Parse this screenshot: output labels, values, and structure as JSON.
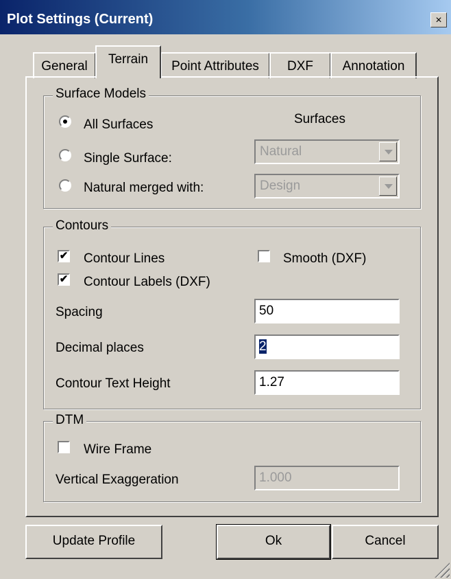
{
  "window": {
    "title": "Plot Settings  (Current)",
    "close_glyph": "×"
  },
  "tabs": [
    {
      "label": "General",
      "active": false
    },
    {
      "label": "Terrain",
      "active": true
    },
    {
      "label": "Point Attributes",
      "active": false
    },
    {
      "label": "DXF",
      "active": false
    },
    {
      "label": "Annotation",
      "active": false
    }
  ],
  "surface_models": {
    "group_label": "Surface Models",
    "surfaces_header": "Surfaces",
    "options": [
      {
        "label": "All Surfaces",
        "checked": true
      },
      {
        "label": "Single Surface:",
        "checked": false
      },
      {
        "label": "Natural merged with:",
        "checked": false
      }
    ],
    "single_surface_select": "Natural",
    "merged_with_select": "Design"
  },
  "contours": {
    "group_label": "Contours",
    "contour_lines": {
      "label": "Contour Lines",
      "checked": true
    },
    "smooth_dxf": {
      "label": "Smooth (DXF)",
      "checked": false
    },
    "contour_labels": {
      "label": "Contour Labels (DXF)",
      "checked": true
    },
    "spacing": {
      "label": "Spacing",
      "value": "50"
    },
    "decimal_places": {
      "label": "Decimal places",
      "value": "2"
    },
    "text_height": {
      "label": "Contour Text Height",
      "value": "1.27"
    }
  },
  "dtm": {
    "group_label": "DTM",
    "wire_frame": {
      "label": "Wire Frame",
      "checked": false
    },
    "vertical_exaggeration": {
      "label": "Vertical Exaggeration",
      "value": "1.000"
    }
  },
  "buttons": {
    "update_profile": "Update Profile",
    "ok": "Ok",
    "cancel": "Cancel"
  },
  "icons": {
    "check_mark": "✔"
  },
  "colors": {
    "titlebar_start": "#0a246a",
    "titlebar_end": "#a6caf0",
    "face": "#d4d0c8",
    "selection": "#0a246a"
  }
}
